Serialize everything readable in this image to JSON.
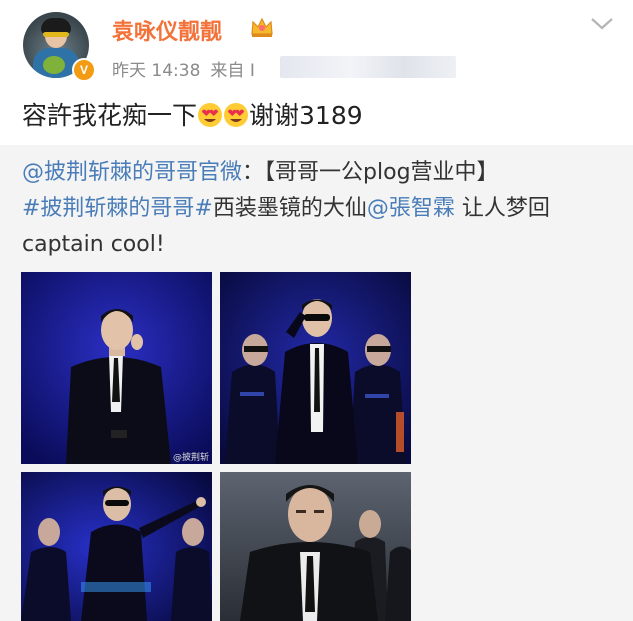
{
  "user": {
    "name": "袁咏仪靓靓",
    "verified_badge": "V"
  },
  "meta": {
    "time": "昨天 14:38",
    "from_label": "来自",
    "source_partial": "I"
  },
  "post": {
    "text_before": "容許我花痴一下",
    "text_after": "谢谢3189"
  },
  "repost": {
    "author_mention": "@披荆斩棘的哥哥官微",
    "colon": "：",
    "bracket_title": "【哥哥一公plog营业中】",
    "hashtag": "#披荆斩棘的哥哥#",
    "text_mid": "西装墨镜的大仙",
    "mention": "@張智霖",
    "text_end": " 让人梦回",
    "text_line3": "captain cool!"
  },
  "images": [
    {
      "desc_name": "photo-1",
      "watermark": "@披荆斩"
    },
    {
      "desc_name": "photo-2"
    },
    {
      "desc_name": "photo-3"
    },
    {
      "desc_name": "photo-4"
    }
  ],
  "colors": {
    "username": "#f3723a",
    "link": "#4a7db8",
    "meta": "#8a8a8a",
    "badge": "#f39c12",
    "repost_bg": "#f4f4f4"
  },
  "icons": [
    "crown-icon",
    "chevron-down-icon",
    "heart-eyes-emoji",
    "verified-badge-icon"
  ]
}
